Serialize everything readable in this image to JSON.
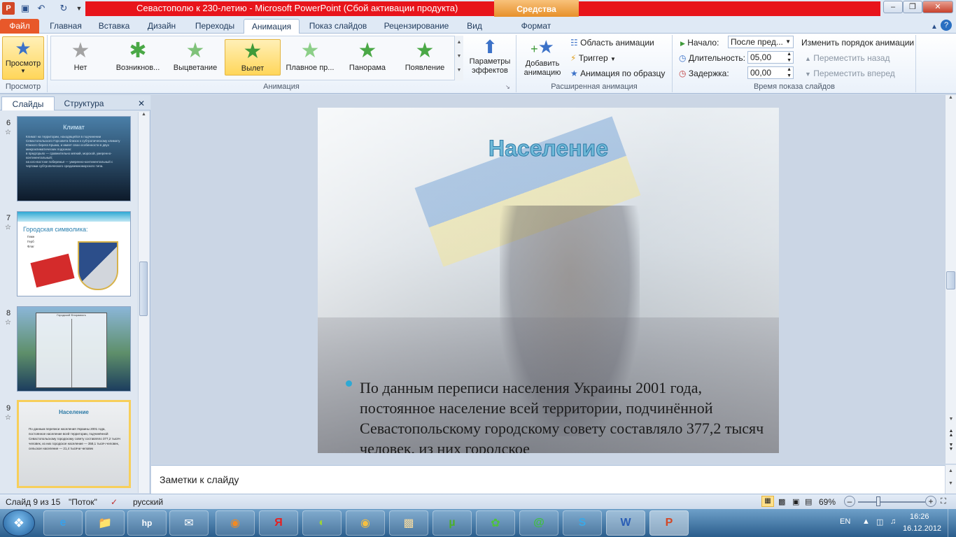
{
  "window": {
    "title": "Севастополю к 230-летию  -  Microsoft PowerPoint (Сбой активации продукта)",
    "context_tab": "Средства рисования",
    "controls": {
      "minimize": "–",
      "restore": "❐",
      "close": "✕"
    }
  },
  "ribbon_tabs": [
    {
      "label": "Файл"
    },
    {
      "label": "Главная"
    },
    {
      "label": "Вставка"
    },
    {
      "label": "Дизайн"
    },
    {
      "label": "Переходы"
    },
    {
      "label": "Анимация"
    },
    {
      "label": "Показ слайдов"
    },
    {
      "label": "Рецензирование"
    },
    {
      "label": "Вид"
    },
    {
      "label": "Формат"
    }
  ],
  "ribbon": {
    "preview": {
      "label": "Просмотр",
      "group": "Просмотр"
    },
    "animations": {
      "group": "Анимация",
      "items": [
        {
          "label": "Нет"
        },
        {
          "label": "Возникнов..."
        },
        {
          "label": "Выцветание"
        },
        {
          "label": "Вылет"
        },
        {
          "label": "Плавное пр..."
        },
        {
          "label": "Панорама"
        },
        {
          "label": "Появление"
        }
      ],
      "effect_options": "Параметры эффектов"
    },
    "advanced": {
      "group": "Расширенная анимация",
      "add_animation": "Добавить анимацию",
      "animation_pane": "Область анимации",
      "trigger": "Триггер",
      "painter": "Анимация по образцу"
    },
    "timing": {
      "group": "Время показа слайдов",
      "start_label": "Начало:",
      "start_value": "После пред...",
      "duration_label": "Длительность:",
      "duration_value": "05,00",
      "delay_label": "Задержка:",
      "delay_value": "00,00",
      "reorder": "Изменить порядок анимации",
      "move_back": "Переместить назад",
      "move_forward": "Переместить вперед"
    }
  },
  "pane_tabs": {
    "slides": "Слайды",
    "outline": "Структура",
    "close": "✕"
  },
  "thumbnails": [
    {
      "num": "6",
      "title": "Климат",
      "lines": [
        "Климат на территории, находящейся в подчинении Севастопольского Горсовета близок к субтропическому климату Южного берега Крыма, и имеет свои особенности в двух микроклиматических подзонах:",
        "в предгорьях — сравнительно мягкий, морской, умеренно-континентальный;",
        "на юго-востоке побережья — умеренно-континентальный с чертами субтропического средиземноморского типа."
      ]
    },
    {
      "num": "7",
      "title": "Городская символика:",
      "lines": [
        "Гимн",
        "Герб",
        "Флаг"
      ]
    },
    {
      "num": "8",
      "title": "Городской Флорамосъ",
      "lines": []
    },
    {
      "num": "9",
      "title": "Население",
      "lines": [
        "По данным переписи населения Украины 2001 года, постоянное население всей территории, подчинённой Севастопольскому городскому совету составляло 377,2 тысяч человек, из них городское население — 358,1 тысяч человек, сельское население — 21,4 тысячи человек"
      ]
    }
  ],
  "slide": {
    "title": "Население",
    "body": "По данным переписи населения Украины 2001 года, постоянное население всей территории, подчинённой Севастопольскому городскому совету составляло 377,2 тысяч человек, из них городское"
  },
  "notes": {
    "placeholder": "Заметки к слайду"
  },
  "status": {
    "slide_counter": "Слайд 9 из 15",
    "theme": "\"Поток\"",
    "language": "русский",
    "zoom": "69%"
  },
  "tray": {
    "lang": "EN",
    "time": "16:26",
    "date": "16.12.2012"
  },
  "taskbar_apps": [
    "ie-icon",
    "explorer-icon",
    "hp-icon",
    "mail-icon",
    "firefox-icon",
    "yandex-icon",
    "app-icon",
    "player-icon",
    "viewer-icon",
    "utorrent-icon",
    "icq-icon",
    "agent-icon",
    "skype-icon",
    "word-icon",
    "powerpoint-icon"
  ],
  "colors": {
    "accent": "#e8582a",
    "title_red": "#e8141b",
    "slide_title": "#6fb9d8",
    "bullet": "#2ea9d4"
  }
}
